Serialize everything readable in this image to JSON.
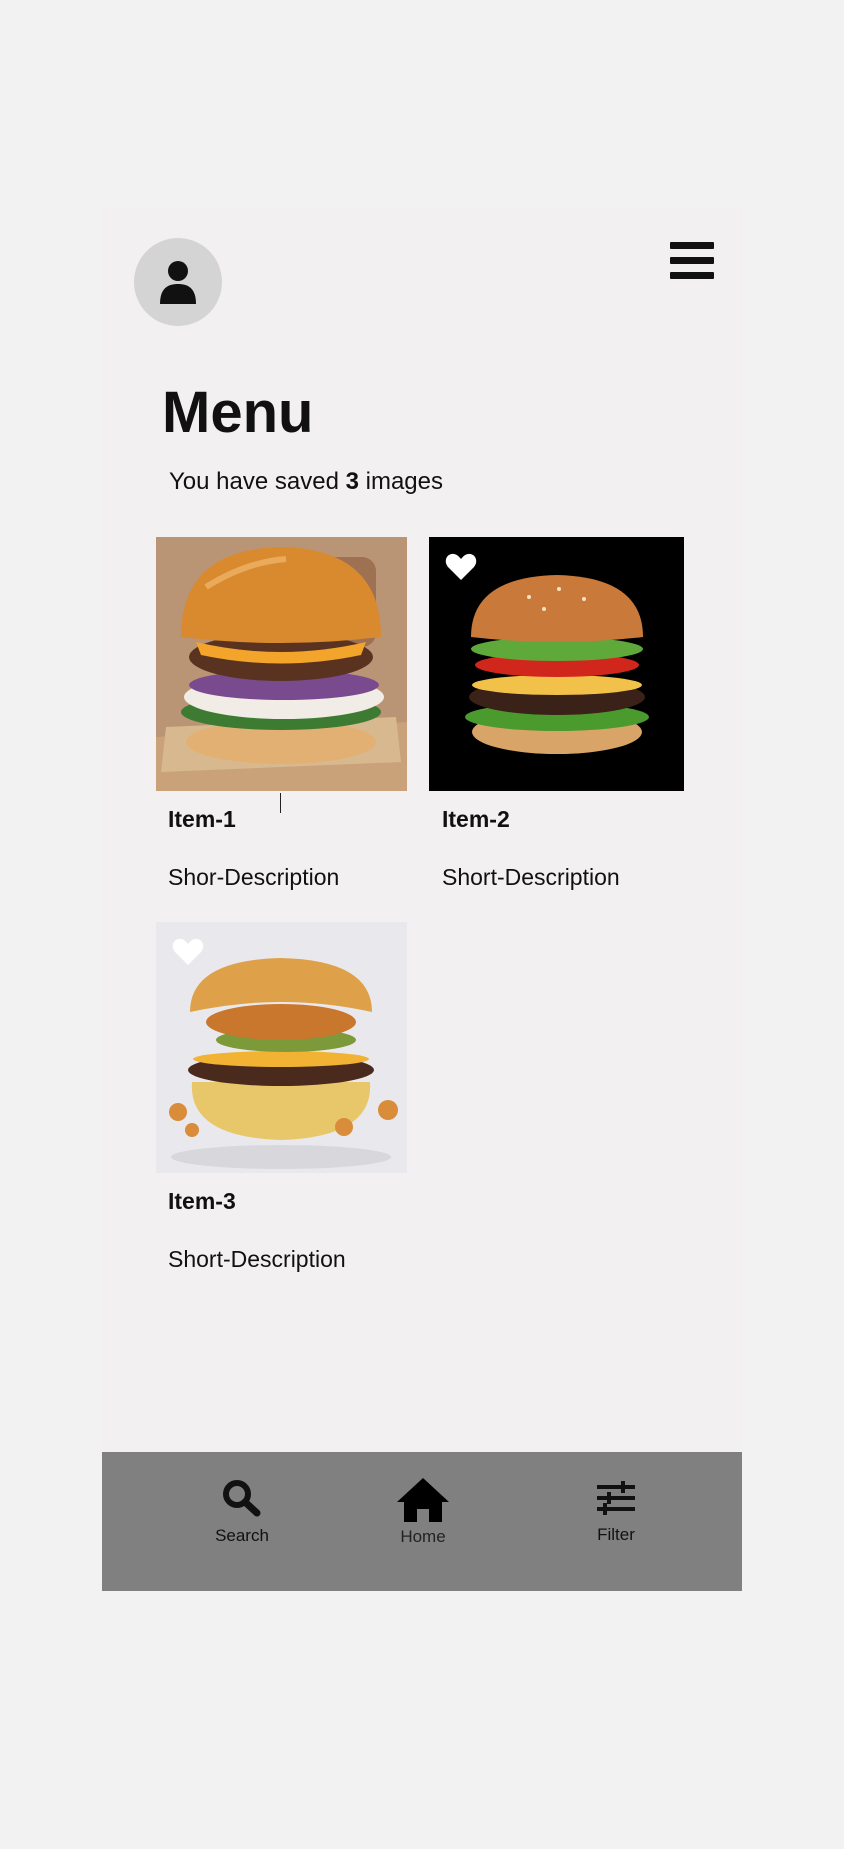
{
  "header": {
    "profile_icon": "person-icon",
    "menu_icon": "hamburger-menu-icon"
  },
  "page": {
    "title": "Menu",
    "saved_prefix": "You have saved ",
    "saved_count": "3",
    "saved_suffix": " images"
  },
  "items": [
    {
      "name": "Item-1",
      "description": "Shor-Description",
      "favorite": false
    },
    {
      "name": "Item-2",
      "description": "Short-Description",
      "favorite": true
    },
    {
      "name": "Item-3",
      "description": "Short-Description",
      "favorite": true
    }
  ],
  "nav": {
    "search_label": "Search",
    "home_label": "Home",
    "filter_label": "Filter"
  },
  "colors": {
    "page_bg": "#f2f2f2",
    "frame_bg": "#f3f0f2",
    "navbar_bg": "#808080",
    "avatar_bg": "#d4d4d4"
  }
}
